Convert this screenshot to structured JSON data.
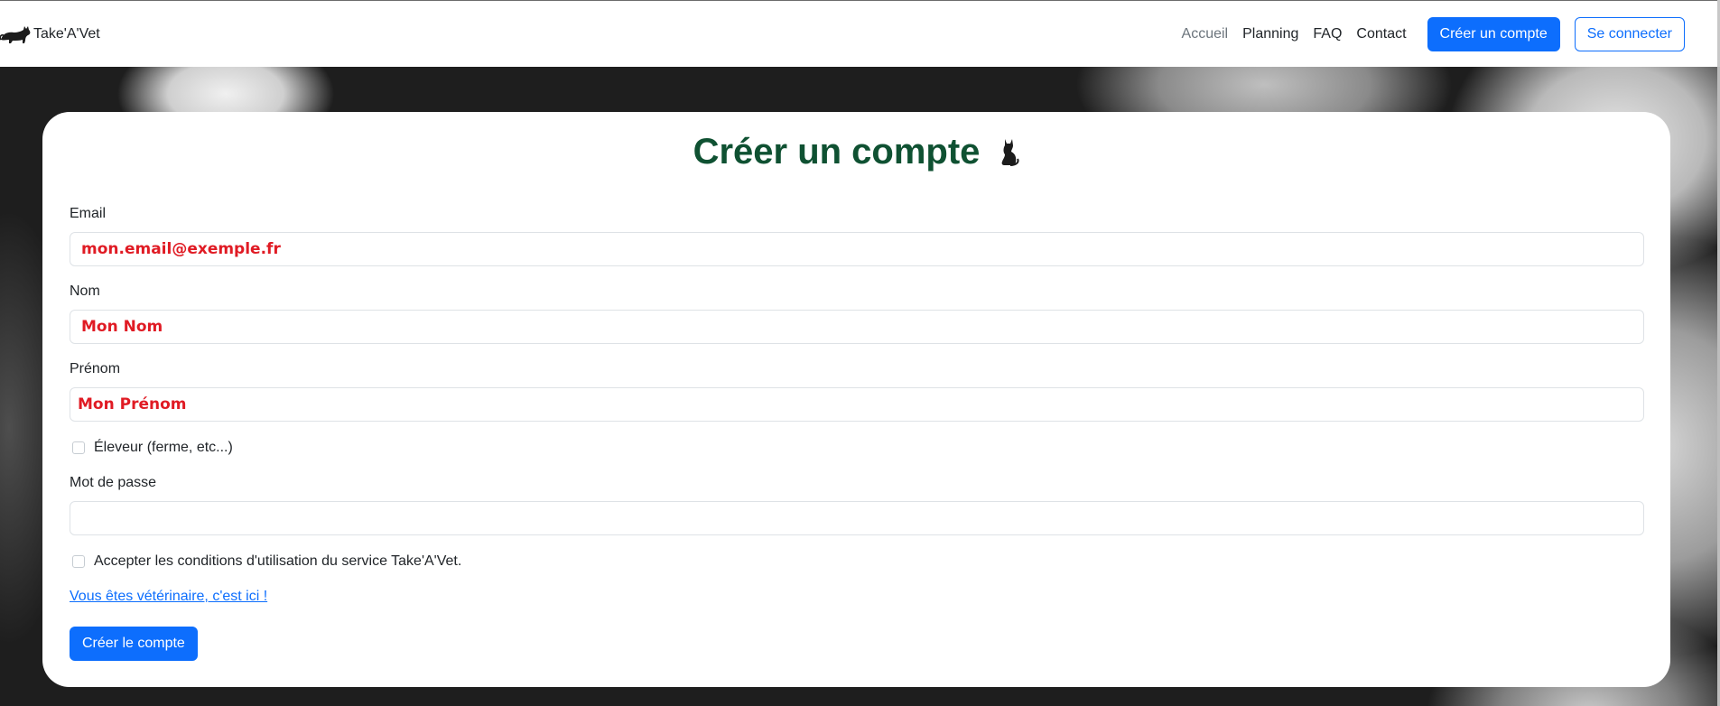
{
  "brand": {
    "name": "Take'A'Vet",
    "logo_icon": "cat-logo-icon"
  },
  "nav": {
    "links": [
      "Accueil",
      "Planning",
      "FAQ",
      "Contact"
    ],
    "create_account_label": "Créer un compte",
    "login_label": "Se connecter"
  },
  "form": {
    "title": "Créer un compte",
    "title_icon": "cat-icon",
    "email_label": "Email",
    "email_value": "mon.email@exemple.fr",
    "nom_label": "Nom",
    "nom_value": "Mon Nom",
    "prenom_label": "Prénom",
    "prenom_value": "Mon Prénom",
    "eleveur_label": "Éleveur (ferme, etc...)",
    "password_label": "Mot de passe",
    "password_value": "",
    "terms_label": "Accepter les conditions d'utilisation du service Take'A'Vet.",
    "vet_link": "Vous êtes vétérinaire, c'est ici !",
    "submit_label": "Créer le compte"
  },
  "colors": {
    "primary": "#0d6efd",
    "title": "#0f5132",
    "input_text": "#e01b24"
  }
}
